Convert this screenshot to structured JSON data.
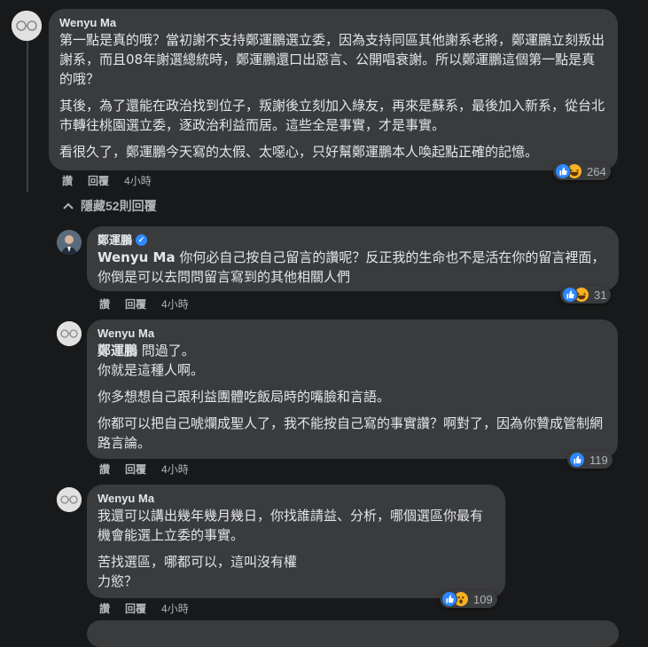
{
  "comments": [
    {
      "author": "Wenyu Ma",
      "paragraphs": [
        "第一點是真的哦？當初謝不支持鄭運鵬選立委，因為支持同區其他謝系老將，鄭運鵬立刻叛出謝系，而且08年謝選總統時，鄭運鵬還口出惡言、公開唱衰謝。所以鄭運鵬這個第一點是真的哦？",
        "其後，為了還能在政治找到位子，叛謝後立刻加入綠友，再來是蘇系，最後加入新系，從台北市轉往桃園選立委，逐政治利益而居。這些全是事實，才是事實。",
        "看很久了，鄭運鵬今天寫的太假、太噁心，只好幫鄭運鵬本人喚起點正確的記憶。"
      ],
      "actions": {
        "like": "讚",
        "reply": "回覆",
        "time": "4小時"
      },
      "reaction_count": "264"
    },
    {
      "author": "鄭運鵬",
      "mention": "Wenyu Ma",
      "paragraphs": [
        "你何必自己按自己留言的讚呢？反正我的生命也不是活在你的留言裡面，你倒是可以去問問留言寫到的其他相關人們"
      ],
      "actions": {
        "like": "讚",
        "reply": "回覆",
        "time": "4小時"
      },
      "reaction_count": "31"
    },
    {
      "author": "Wenyu Ma",
      "mention": "鄭運鵬",
      "first_line": "問過了。",
      "paragraphs": [
        "你就是這種人啊。",
        "你多想想自己跟利益團體吃飯局時的嘴臉和言語。",
        "你都可以把自己唬爛成聖人了，我不能按自己寫的事實讚？啊對了，因為你贊成管制網路言論。"
      ],
      "actions": {
        "like": "讚",
        "reply": "回覆",
        "time": "4小時"
      },
      "reaction_count": "119"
    },
    {
      "author": "Wenyu Ma",
      "paragraphs": [
        "我還可以講出幾年幾月幾日，你找誰請益、分析，哪個選區你最有機會能選上立委的事實。",
        "苦找選區，哪都可以，這叫沒有權力慾？"
      ],
      "actions": {
        "like": "讚",
        "reply": "回覆",
        "time": "4小時"
      },
      "reaction_count": "109"
    }
  ],
  "hidden_replies_label": "隱藏52則回覆"
}
